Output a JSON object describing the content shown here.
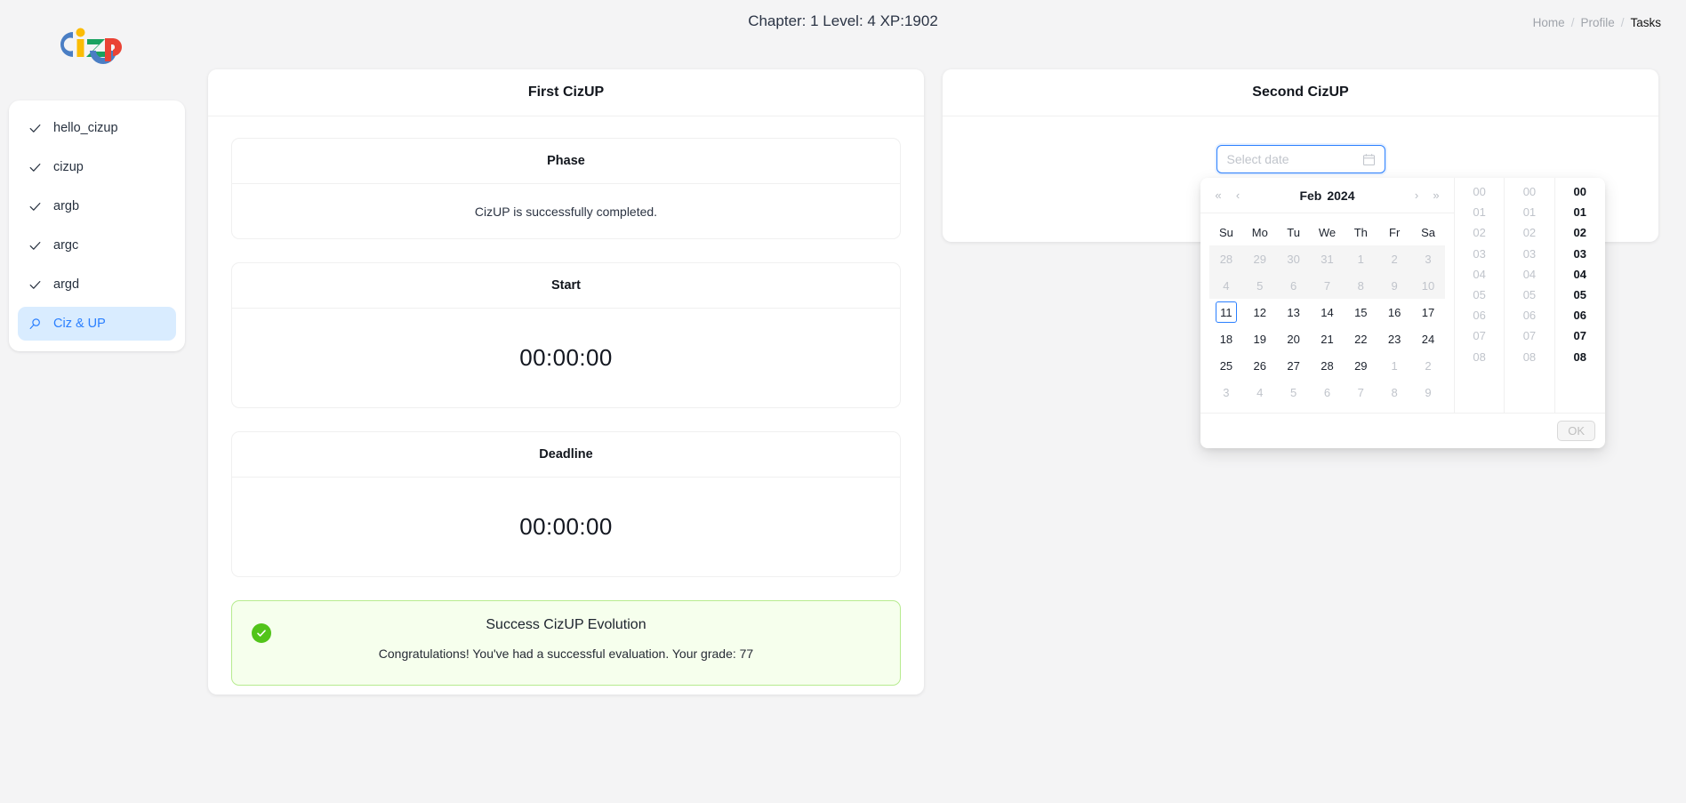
{
  "header": {
    "title": "Chapter: 1 Level: 4 XP:1902",
    "breadcrumb": [
      {
        "label": "Home",
        "current": false
      },
      {
        "label": "Profile",
        "current": false
      },
      {
        "label": "Tasks",
        "current": true
      }
    ],
    "separator": "/"
  },
  "logo": {
    "alt": "CizUP",
    "colors": {
      "blue": "#4a7ec4",
      "yellow": "#fbbc05",
      "green": "#1aa260",
      "red": "#ea4335"
    }
  },
  "sidebar": {
    "items": [
      {
        "label": "hello_cizup",
        "icon": "check-icon",
        "active": false
      },
      {
        "label": "cizup",
        "icon": "check-icon",
        "active": false
      },
      {
        "label": "argb",
        "icon": "check-icon",
        "active": false
      },
      {
        "label": "argc",
        "icon": "check-icon",
        "active": false
      },
      {
        "label": "argd",
        "icon": "check-icon",
        "active": false
      },
      {
        "label": "Ciz & UP",
        "icon": "search-icon",
        "active": true
      }
    ],
    "active_color": "#2a7fff",
    "active_bg": "#d9ecff"
  },
  "left_card": {
    "title": "First CizUP",
    "phase": {
      "title": "Phase",
      "text": "CizUP is successfully completed."
    },
    "start": {
      "title": "Start",
      "value": "00:00:00"
    },
    "deadline": {
      "title": "Deadline",
      "value": "00:00:00"
    },
    "alert": {
      "icon": "check-circle-icon",
      "title": "Success CizUP Evolution",
      "description": "Congratulations! You've had a successful evaluation. Your grade: 77",
      "grade": 77,
      "bg": "#f6ffed",
      "border": "#b7eb8f",
      "icon_color": "#52c41a"
    }
  },
  "right_card": {
    "title": "Second CizUP",
    "date_picker": {
      "placeholder": "Select date",
      "value": "",
      "icon": "calendar-icon",
      "focused": true
    }
  },
  "datepicker_dropdown": {
    "nav": {
      "super_prev": "«",
      "prev": "‹",
      "next": "›",
      "super_next": "»"
    },
    "month": "Feb",
    "year": "2024",
    "weekdays": [
      "Su",
      "Mo",
      "Tu",
      "We",
      "Th",
      "Fr",
      "Sa"
    ],
    "weeks": [
      {
        "disabled_row": true,
        "days": [
          {
            "d": "28",
            "muted": true
          },
          {
            "d": "29",
            "muted": true
          },
          {
            "d": "30",
            "muted": true
          },
          {
            "d": "31",
            "muted": true
          },
          {
            "d": "1",
            "muted": true
          },
          {
            "d": "2",
            "muted": true
          },
          {
            "d": "3",
            "muted": true
          }
        ]
      },
      {
        "disabled_row": true,
        "days": [
          {
            "d": "4",
            "muted": true
          },
          {
            "d": "5",
            "muted": true
          },
          {
            "d": "6",
            "muted": true
          },
          {
            "d": "7",
            "muted": true
          },
          {
            "d": "8",
            "muted": true
          },
          {
            "d": "9",
            "muted": true
          },
          {
            "d": "10",
            "muted": true
          }
        ]
      },
      {
        "disabled_row": false,
        "days": [
          {
            "d": "11",
            "muted": false,
            "today": true
          },
          {
            "d": "12",
            "muted": false
          },
          {
            "d": "13",
            "muted": false
          },
          {
            "d": "14",
            "muted": false
          },
          {
            "d": "15",
            "muted": false
          },
          {
            "d": "16",
            "muted": false
          },
          {
            "d": "17",
            "muted": false
          }
        ]
      },
      {
        "disabled_row": false,
        "days": [
          {
            "d": "18",
            "muted": false
          },
          {
            "d": "19",
            "muted": false
          },
          {
            "d": "20",
            "muted": false
          },
          {
            "d": "21",
            "muted": false
          },
          {
            "d": "22",
            "muted": false
          },
          {
            "d": "23",
            "muted": false
          },
          {
            "d": "24",
            "muted": false
          }
        ]
      },
      {
        "disabled_row": false,
        "days": [
          {
            "d": "25",
            "muted": false
          },
          {
            "d": "26",
            "muted": false
          },
          {
            "d": "27",
            "muted": false
          },
          {
            "d": "28",
            "muted": false
          },
          {
            "d": "29",
            "muted": false
          },
          {
            "d": "1",
            "muted": true
          },
          {
            "d": "2",
            "muted": true
          }
        ]
      },
      {
        "disabled_row": false,
        "days": [
          {
            "d": "3",
            "muted": true
          },
          {
            "d": "4",
            "muted": true
          },
          {
            "d": "5",
            "muted": true
          },
          {
            "d": "6",
            "muted": true
          },
          {
            "d": "7",
            "muted": true
          },
          {
            "d": "8",
            "muted": true
          },
          {
            "d": "9",
            "muted": true
          }
        ]
      }
    ],
    "time_columns": [
      {
        "name": "hour",
        "active": false,
        "values": [
          "00",
          "01",
          "02",
          "03",
          "04",
          "05",
          "06",
          "07",
          "08"
        ]
      },
      {
        "name": "minute",
        "active": false,
        "values": [
          "00",
          "01",
          "02",
          "03",
          "04",
          "05",
          "06",
          "07",
          "08"
        ]
      },
      {
        "name": "second",
        "active": true,
        "values": [
          "00",
          "01",
          "02",
          "03",
          "04",
          "05",
          "06",
          "07",
          "08"
        ]
      }
    ],
    "ok_label": "OK",
    "ok_disabled": true
  }
}
